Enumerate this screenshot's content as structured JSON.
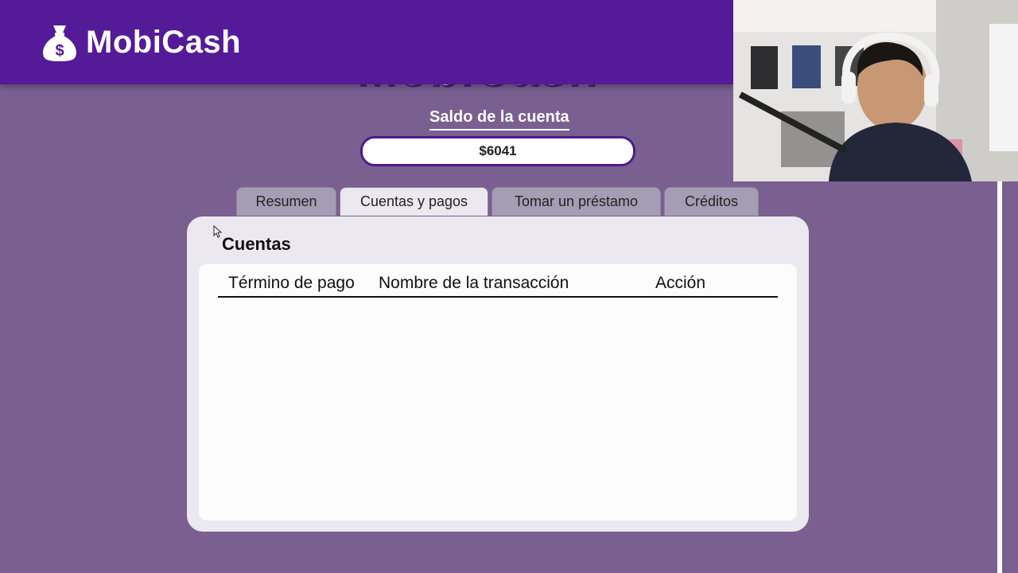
{
  "app": {
    "brand_name": "MobiCash",
    "brand_icon": "money-bag-icon"
  },
  "account": {
    "balance_label": "Saldo de la cuenta",
    "balance_value": "$6041"
  },
  "tabs": [
    {
      "label": "Resumen",
      "active": false
    },
    {
      "label": "Cuentas y pagos",
      "active": true
    },
    {
      "label": "Tomar un préstamo",
      "active": false
    },
    {
      "label": "Créditos",
      "active": false
    }
  ],
  "panel": {
    "title": "Cuentas",
    "columns": [
      "Término de pago",
      "Nombre de la transacción",
      "Acción"
    ],
    "rows": []
  },
  "colors": {
    "header": "#541a98",
    "page_background": "#7a5f91",
    "panel": "#ebe8ef",
    "accent_border": "#4e1a8c"
  }
}
